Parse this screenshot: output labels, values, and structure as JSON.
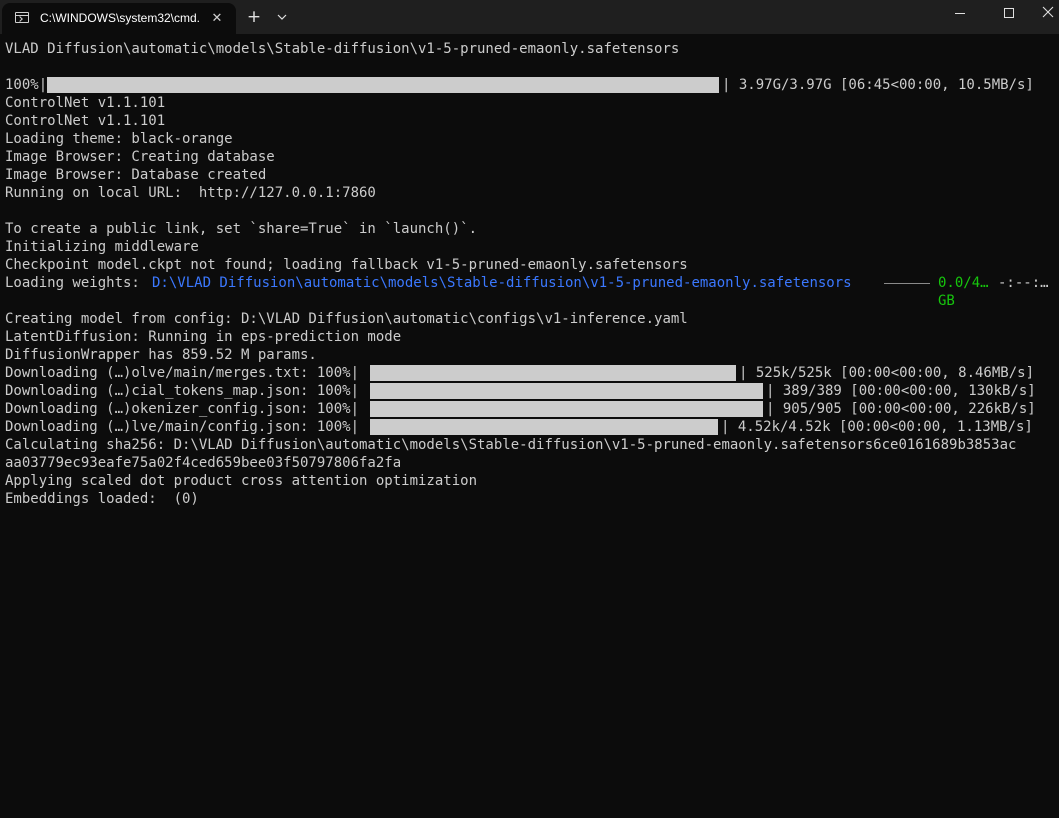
{
  "window": {
    "tab_title": "C:\\WINDOWS\\system32\\cmd.",
    "tab_close_glyph": "✕",
    "new_tab_glyph": "+"
  },
  "console": {
    "lines": [
      "VLAD Diffusion\\automatic\\models\\Stable-diffusion\\v1-5-pruned-emaonly.safetensors",
      "",
      "100%|",
      "ControlNet v1.1.101",
      "ControlNet v1.1.101",
      "Loading theme: black-orange",
      "Image Browser: Creating database",
      "Image Browser: Database created",
      "Running on local URL:  http://127.0.0.1:7860",
      "",
      "To create a public link, set `share=True` in `launch()`.",
      "Initializing middleware",
      "Checkpoint model.ckpt not found; loading fallback v1-5-pruned-emaonly.safetensors",
      "Loading weights: ",
      "",
      "Creating model from config: D:\\VLAD Diffusion\\automatic\\configs\\v1-inference.yaml",
      "LatentDiffusion: Running in eps-prediction mode",
      "DiffusionWrapper has 859.52 M params.",
      "Downloading (…)olve/main/merges.txt: 100%|",
      "Downloading (…)cial_tokens_map.json: 100%|",
      "Downloading (…)okenizer_config.json: 100%|",
      "Downloading (…)lve/main/config.json: 100%|",
      "Calculating sha256: D:\\VLAD Diffusion\\automatic\\models\\Stable-diffusion\\v1-5-pruned-emaonly.safetensors6ce0161689b3853ac",
      "aa03779ec93eafe75a02f4ced659bee03f50797806fa2fa",
      "Applying scaled dot product cross attention optimization",
      "Embeddings loaded:  (0)"
    ],
    "main_progress": {
      "fraction": 1.0,
      "suffix": "| 3.97G/3.97G [06:45<00:00, 10.5MB/s]"
    },
    "weights_path": "D:\\VLAD Diffusion\\automatic\\models\\Stable-diffusion\\v1-5-pruned-emaonly.safetensors",
    "weights_progress_text": "0.0/4…",
    "weights_progress_unit": "GB",
    "weights_eta": "-:--:…",
    "downloads": [
      {
        "fraction": 1.0,
        "suffix": "| 525k/525k [00:00<00:00, 8.46MB/s]"
      },
      {
        "fraction": 1.0,
        "suffix": "| 389/389 [00:00<00:00, 130kB/s]"
      },
      {
        "fraction": 1.0,
        "suffix": "| 905/905 [00:00<00:00, 226kB/s]"
      },
      {
        "fraction": 1.0,
        "suffix": "| 4.52k/4.52k [00:00<00:00, 1.13MB/s]"
      }
    ],
    "embeddings_count": "0"
  },
  "colors": {
    "background": "#0c0c0c",
    "text": "#cccccc",
    "path_blue": "#3b78ff",
    "progress_green": "#16c60c"
  },
  "icons": {
    "tab": "terminal-icon",
    "close": "close-icon",
    "new_tab": "plus-icon",
    "dropdown": "chevron-down-icon",
    "minimize": "minimize-icon",
    "maximize": "maximize-icon",
    "window_close": "window-close-icon"
  }
}
